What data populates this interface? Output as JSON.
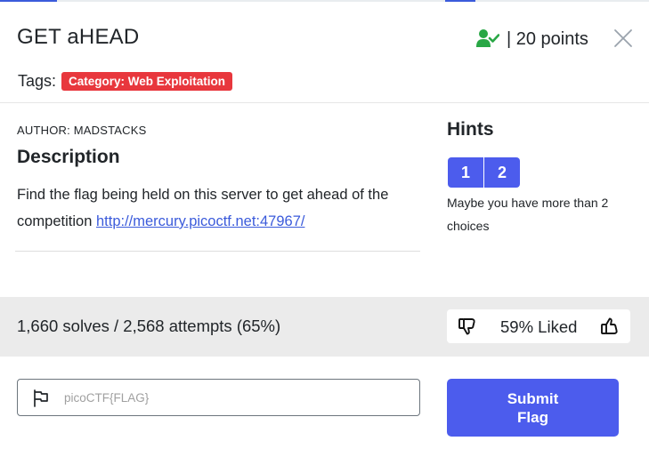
{
  "challenge": {
    "title": "GET aHEAD",
    "points_text": "| 20 points",
    "tags_label": "Tags:",
    "tag": "Category: Web Exploitation",
    "author": "AUTHOR: MADSTACKS",
    "description_heading": "Description",
    "description_text": "Find the flag being held on this server to get ahead of the competition ",
    "description_link": "http://mercury.picoctf.net:47967/"
  },
  "hints": {
    "heading": "Hints",
    "buttons": [
      "1",
      "2"
    ],
    "active_hint_text": "Maybe you have more than 2 choices"
  },
  "stats": {
    "solves_text": "1,660 solves / 2,568 attempts (65%)",
    "liked_text": "59% Liked"
  },
  "flag_form": {
    "placeholder": "picoCTF{FLAG}",
    "value": "",
    "submit_label": "Submit Flag"
  },
  "colors": {
    "accent": "#4c5ced",
    "tag_red": "#e8373d",
    "solved_green": "#28a745",
    "link_blue": "#3b5bdb",
    "stats_bg": "#ebebeb"
  },
  "icons": {
    "solved": "user-check-icon",
    "close": "close-icon",
    "thumbs_down": "thumbs-down-icon",
    "thumbs_up": "thumbs-up-icon",
    "flag": "flag-icon"
  }
}
